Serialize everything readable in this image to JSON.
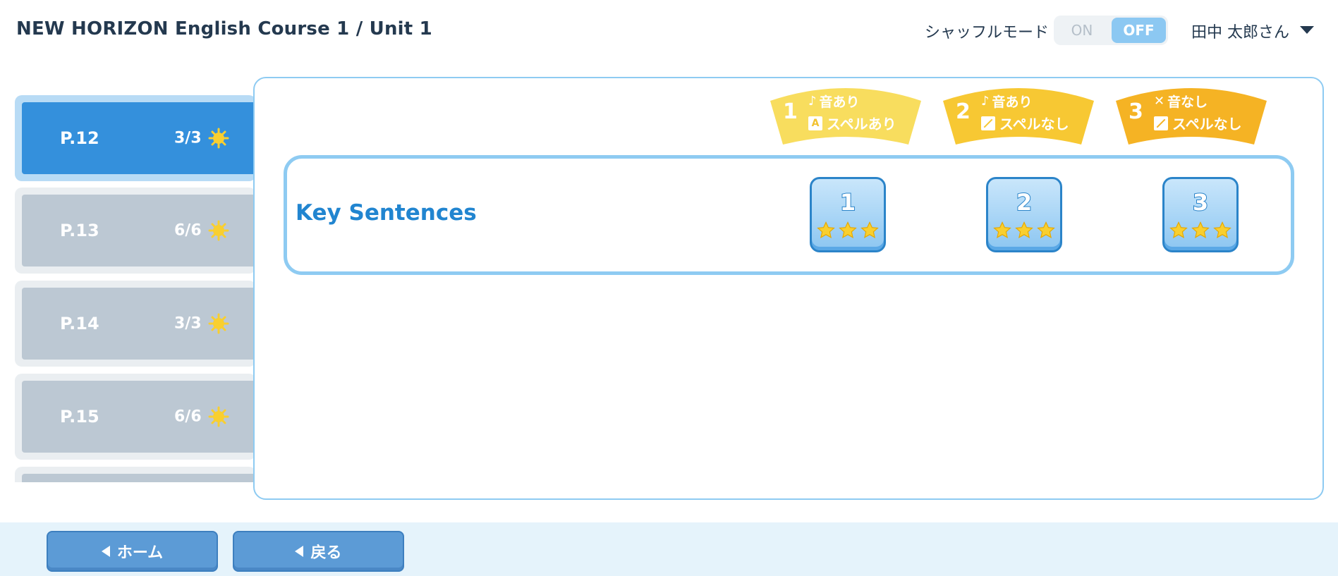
{
  "header": {
    "title": "NEW HORIZON English Course 1 / Unit 1",
    "shuffle_label": "シャッフルモード",
    "toggle_on": "ON",
    "toggle_off": "OFF",
    "toggle_selected": "OFF",
    "user_name": "田中 太郎さん"
  },
  "sidebar": {
    "items": [
      {
        "page": "P.12",
        "score": "3/3",
        "active": true
      },
      {
        "page": "P.13",
        "score": "6/6",
        "active": false
      },
      {
        "page": "P.14",
        "score": "3/3",
        "active": false
      },
      {
        "page": "P.15",
        "score": "6/6",
        "active": false
      }
    ]
  },
  "levels": [
    {
      "num": "1",
      "sound": "音あり",
      "spell": "スペルあり",
      "sound_icon": "music-note-icon",
      "spell_icon": "letter-a-icon",
      "color": "#f8dd5e"
    },
    {
      "num": "2",
      "sound": "音あり",
      "spell": "スペルなし",
      "sound_icon": "music-note-icon",
      "spell_icon": "no-letter-icon",
      "color": "#f7c833"
    },
    {
      "num": "3",
      "sound": "音なし",
      "spell": "スペルなし",
      "sound_icon": "muted-note-icon",
      "spell_icon": "no-letter-icon",
      "color": "#f5b324"
    }
  ],
  "section": {
    "label": "Key Sentences",
    "buttons": [
      {
        "num": "1",
        "stars": 3
      },
      {
        "num": "2",
        "stars": 3
      },
      {
        "num": "3",
        "stars": 3
      }
    ]
  },
  "footer": {
    "home_label": "ホーム",
    "back_label": "戻る"
  },
  "colors": {
    "active_item": "#3490dc",
    "inactive_item": "#bcc8d3",
    "panel_border": "#8ecbf2",
    "title_text": "#24394f",
    "star": "#f9cf2f"
  }
}
